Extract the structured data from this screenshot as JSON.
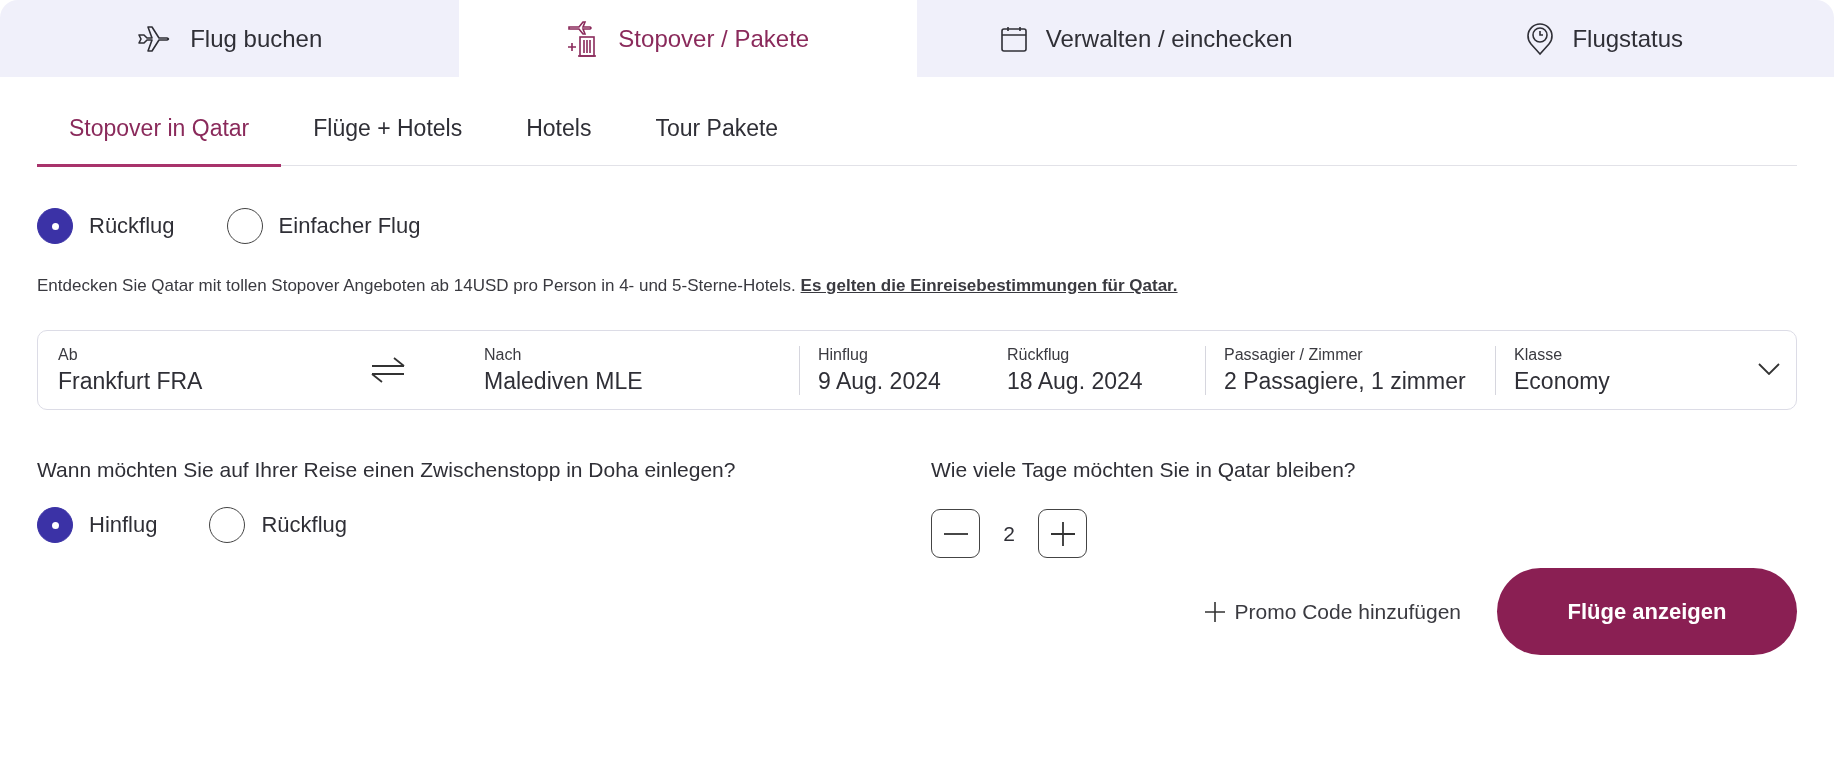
{
  "main_tabs": [
    {
      "label": "Flug buchen",
      "kind": "plane",
      "selected": false
    },
    {
      "label": "Stopover / Pakete",
      "kind": "hotel",
      "selected": true
    },
    {
      "label": "Verwalten / einchecken",
      "kind": "calendar",
      "selected": false
    },
    {
      "label": "Flugstatus",
      "kind": "pin",
      "selected": false
    }
  ],
  "sub_tabs": [
    {
      "label": "Stopover in Qatar",
      "selected": true
    },
    {
      "label": "Flüge + Hotels",
      "selected": false
    },
    {
      "label": "Hotels",
      "selected": false
    },
    {
      "label": "Tour Pakete",
      "selected": false
    }
  ],
  "trip_type": [
    {
      "label": "Rückflug",
      "selected": true
    },
    {
      "label": "Einfacher Flug",
      "selected": false
    }
  ],
  "info": {
    "text": "Entdecken Sie Qatar mit tollen Stopover Angeboten ab 14USD pro Person in 4- und 5-Sterne-Hotels.",
    "link": "Es gelten die Einreisebestimmungen für Qatar."
  },
  "search_fields": [
    {
      "kind": "location",
      "label": "Ab",
      "value": "Frankfurt FRA"
    },
    {
      "kind": "location",
      "label": "Nach",
      "value": "Malediven MLE"
    },
    {
      "kind": "date",
      "label": "Hinflug",
      "value": "9 Aug. 2024"
    },
    {
      "kind": "date",
      "label": "Rückflug",
      "value": "18 Aug. 2024"
    },
    {
      "kind": "guests",
      "label": "Passagier / Zimmer",
      "value": "2 Passagiere, 1 zimmer"
    },
    {
      "kind": "select",
      "label": "Klasse",
      "value": "Economy"
    }
  ],
  "stopover": {
    "question": "Wann möchten Sie auf Ihrer Reise einen Zwischenstopp in Doha einlegen?",
    "options": [
      {
        "label": "Hinflug",
        "selected": true
      },
      {
        "label": "Rückflug",
        "selected": false
      }
    ],
    "days_question": "Wie viele Tage möchten Sie in Qatar bleiben?",
    "days": "2"
  },
  "promo": "Promo Code hinzufügen",
  "submit": "Flüge anzeigen"
}
